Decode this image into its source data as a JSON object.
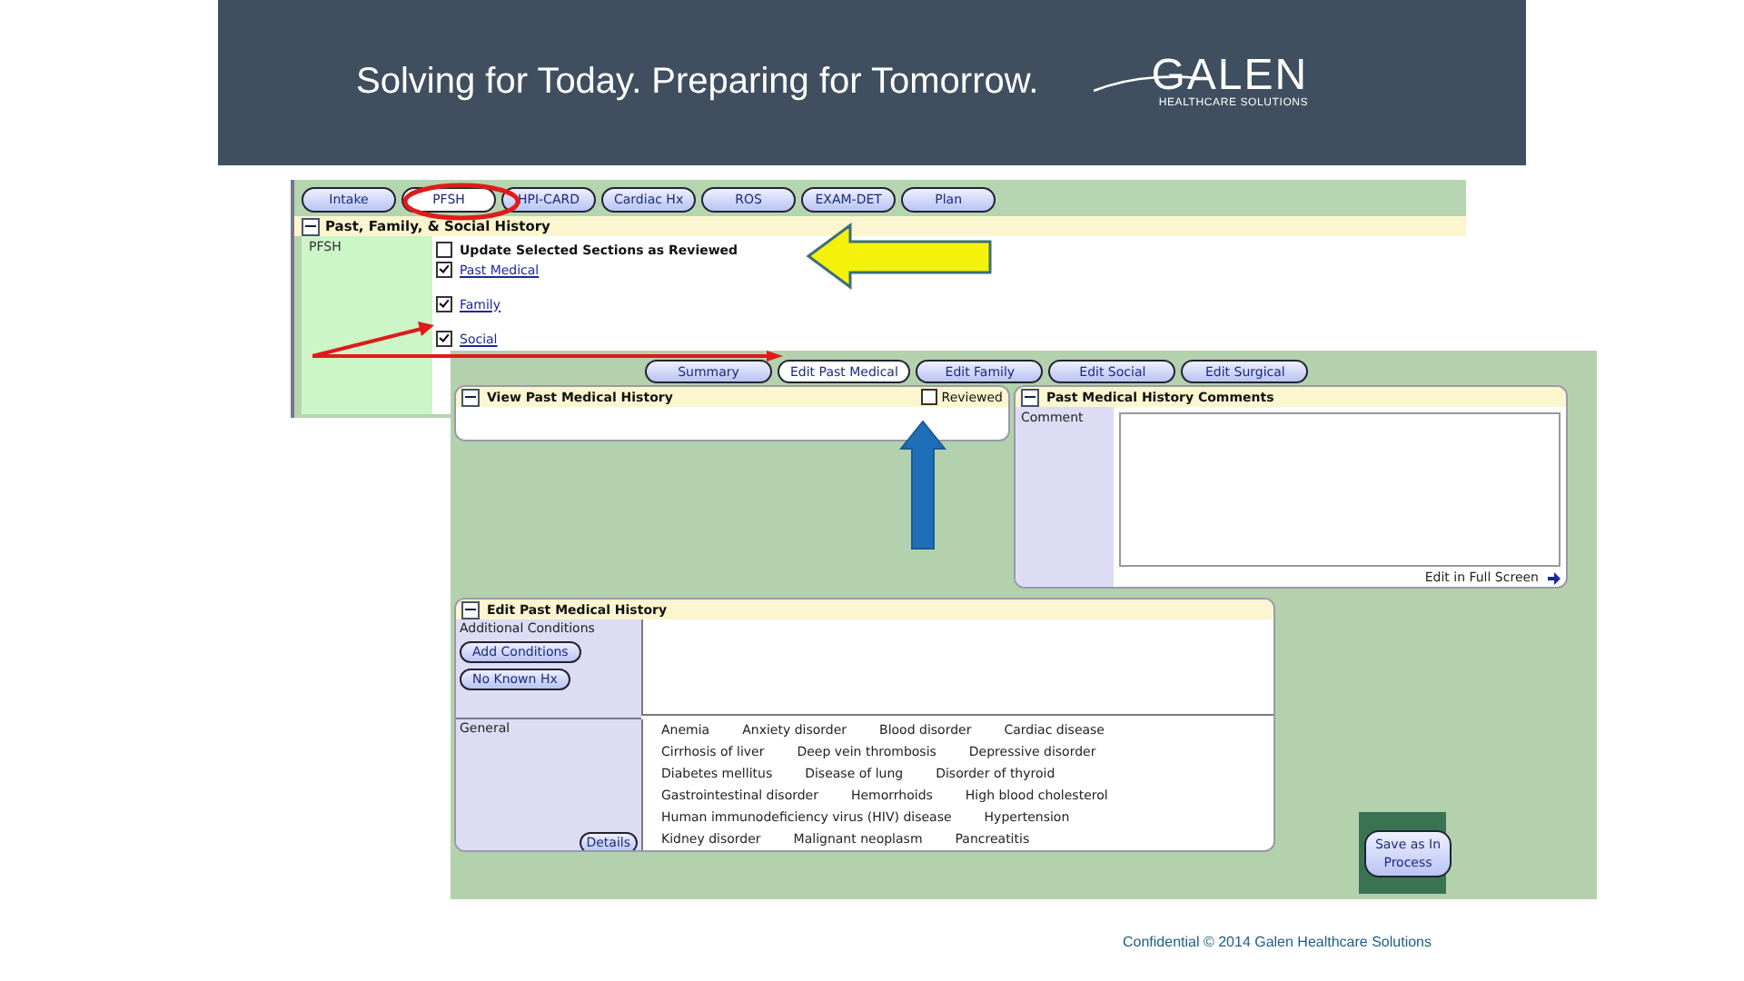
{
  "header": {
    "tagline": "Solving for Today. Preparing for Tomorrow.",
    "logo": {
      "name": "GALEN",
      "subtitle": "HEALTHCARE SOLUTIONS"
    }
  },
  "screen_1": {
    "tabs": [
      {
        "label": "Intake",
        "selected": false
      },
      {
        "label": "PFSH",
        "selected": true
      },
      {
        "label": "HPI-CARD",
        "selected": false
      },
      {
        "label": "Cardiac Hx",
        "selected": false
      },
      {
        "label": "ROS",
        "selected": false
      },
      {
        "label": "EXAM-DET",
        "selected": false
      },
      {
        "label": "Plan",
        "selected": false
      }
    ],
    "section_title": "Past, Family, & Social History",
    "sidebar_label": "PFSH",
    "update_option": {
      "label": "Update Selected Sections as Reviewed",
      "checked": false
    },
    "sections": [
      {
        "label": "Past Medical",
        "checked": true
      },
      {
        "label": "Family",
        "checked": true
      },
      {
        "label": "Social",
        "checked": true
      }
    ]
  },
  "screen_2": {
    "buttons": [
      {
        "label": "Summary",
        "selected": false
      },
      {
        "label": "Edit Past Medical",
        "selected": true
      },
      {
        "label": "Edit Family",
        "selected": false
      },
      {
        "label": "Edit Social",
        "selected": false
      },
      {
        "label": "Edit Surgical",
        "selected": false
      }
    ],
    "view_panel": {
      "title": "View Past Medical History",
      "reviewed": {
        "label": "Reviewed",
        "checked": false
      }
    },
    "comments_panel": {
      "title": "Past Medical History Comments",
      "comment_label": "Comment",
      "link": "Edit in Full Screen"
    },
    "edit_panel": {
      "title": "Edit Past Medical History",
      "additional_label": "Additional Conditions",
      "add_button": "Add Conditions",
      "no_known_button": "No Known Hx",
      "general_label": "General",
      "general_button": "Details",
      "conditions": [
        [
          "Anemia",
          "Anxiety disorder",
          "Blood disorder",
          "Cardiac disease"
        ],
        [
          "Cirrhosis of liver",
          "Deep vein thrombosis",
          "Depressive disorder"
        ],
        [
          "Diabetes mellitus",
          "Disease of lung",
          "Disorder of thyroid"
        ],
        [
          "Gastrointestinal disorder",
          "Hemorrhoids",
          "High blood cholesterol"
        ],
        [
          "Human immunodeficiency virus (HIV) disease",
          "Hypertension"
        ],
        [
          "Kidney disorder",
          "Malignant neoplasm",
          "Pancreatitis"
        ]
      ]
    },
    "save_button": "Save as In Process"
  },
  "footer": "Confidential © 2014 Galen Healthcare Solutions"
}
